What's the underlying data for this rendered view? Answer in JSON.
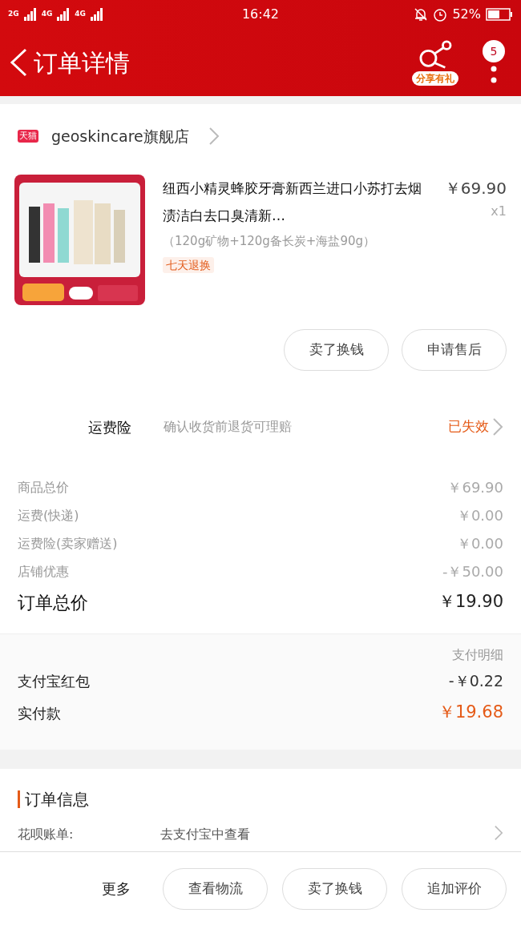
{
  "status_bar": {
    "network": [
      "2G",
      "4G",
      "4G"
    ],
    "time": "16:42",
    "battery": "52%"
  },
  "nav": {
    "title": "订单详情",
    "share_label": "分享有礼",
    "badge": "5"
  },
  "store": {
    "badge": "天猫",
    "name": "geoskincare旗舰店"
  },
  "product": {
    "title": "纽西小精灵蜂胶牙膏新西兰进口小苏打去烟渍洁白去口臭清新…",
    "variant": "（120g矿物+120g备长炭+海盐90g）",
    "tag": "七天退换",
    "price": "￥69.90",
    "quantity": "x1"
  },
  "item_actions": [
    "卖了换钱",
    "申请售后"
  ],
  "insurance": {
    "label": "运费险",
    "description": "确认收货前退货可理赔",
    "status": "已失效"
  },
  "price_rows": [
    {
      "label": "商品总价",
      "value": "￥69.90",
      "kind": "minor"
    },
    {
      "label": "运费(快递)",
      "value": "￥0.00",
      "kind": "minor"
    },
    {
      "label": "运费险(卖家赠送)",
      "value": "￥0.00",
      "kind": "minor"
    },
    {
      "label": "店铺优惠",
      "value": "-￥50.00",
      "kind": "minor"
    },
    {
      "label": "订单总价",
      "value": "￥19.90",
      "kind": "total"
    }
  ],
  "payment": {
    "detail_link": "支付明细",
    "rows": [
      {
        "label": "支付宝红包",
        "value": "-￥0.22",
        "kind": "normal"
      },
      {
        "label": "实付款",
        "value": "￥19.68",
        "kind": "paid"
      }
    ]
  },
  "order_info": {
    "title": "订单信息",
    "rows": [
      {
        "label": "花呗账单:",
        "value": "去支付宝中查看"
      }
    ]
  },
  "bottom_bar": {
    "more": "更多",
    "buttons": [
      "查看物流",
      "卖了换钱",
      "追加评价"
    ]
  }
}
